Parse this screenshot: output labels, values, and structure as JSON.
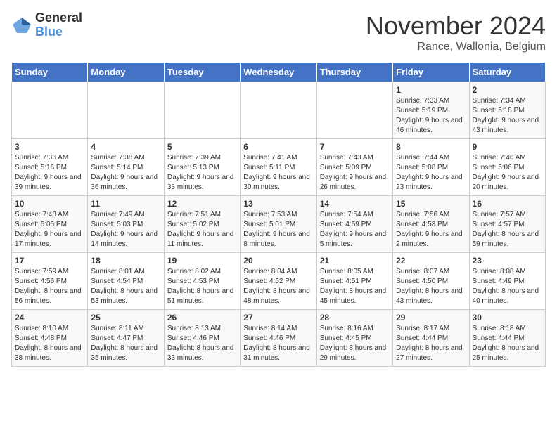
{
  "logo": {
    "general": "General",
    "blue": "Blue"
  },
  "title": "November 2024",
  "subtitle": "Rance, Wallonia, Belgium",
  "days_header": [
    "Sunday",
    "Monday",
    "Tuesday",
    "Wednesday",
    "Thursday",
    "Friday",
    "Saturday"
  ],
  "weeks": [
    [
      {
        "day": "",
        "info": ""
      },
      {
        "day": "",
        "info": ""
      },
      {
        "day": "",
        "info": ""
      },
      {
        "day": "",
        "info": ""
      },
      {
        "day": "",
        "info": ""
      },
      {
        "day": "1",
        "info": "Sunrise: 7:33 AM\nSunset: 5:19 PM\nDaylight: 9 hours and 46 minutes."
      },
      {
        "day": "2",
        "info": "Sunrise: 7:34 AM\nSunset: 5:18 PM\nDaylight: 9 hours and 43 minutes."
      }
    ],
    [
      {
        "day": "3",
        "info": "Sunrise: 7:36 AM\nSunset: 5:16 PM\nDaylight: 9 hours and 39 minutes."
      },
      {
        "day": "4",
        "info": "Sunrise: 7:38 AM\nSunset: 5:14 PM\nDaylight: 9 hours and 36 minutes."
      },
      {
        "day": "5",
        "info": "Sunrise: 7:39 AM\nSunset: 5:13 PM\nDaylight: 9 hours and 33 minutes."
      },
      {
        "day": "6",
        "info": "Sunrise: 7:41 AM\nSunset: 5:11 PM\nDaylight: 9 hours and 30 minutes."
      },
      {
        "day": "7",
        "info": "Sunrise: 7:43 AM\nSunset: 5:09 PM\nDaylight: 9 hours and 26 minutes."
      },
      {
        "day": "8",
        "info": "Sunrise: 7:44 AM\nSunset: 5:08 PM\nDaylight: 9 hours and 23 minutes."
      },
      {
        "day": "9",
        "info": "Sunrise: 7:46 AM\nSunset: 5:06 PM\nDaylight: 9 hours and 20 minutes."
      }
    ],
    [
      {
        "day": "10",
        "info": "Sunrise: 7:48 AM\nSunset: 5:05 PM\nDaylight: 9 hours and 17 minutes."
      },
      {
        "day": "11",
        "info": "Sunrise: 7:49 AM\nSunset: 5:03 PM\nDaylight: 9 hours and 14 minutes."
      },
      {
        "day": "12",
        "info": "Sunrise: 7:51 AM\nSunset: 5:02 PM\nDaylight: 9 hours and 11 minutes."
      },
      {
        "day": "13",
        "info": "Sunrise: 7:53 AM\nSunset: 5:01 PM\nDaylight: 9 hours and 8 minutes."
      },
      {
        "day": "14",
        "info": "Sunrise: 7:54 AM\nSunset: 4:59 PM\nDaylight: 9 hours and 5 minutes."
      },
      {
        "day": "15",
        "info": "Sunrise: 7:56 AM\nSunset: 4:58 PM\nDaylight: 9 hours and 2 minutes."
      },
      {
        "day": "16",
        "info": "Sunrise: 7:57 AM\nSunset: 4:57 PM\nDaylight: 8 hours and 59 minutes."
      }
    ],
    [
      {
        "day": "17",
        "info": "Sunrise: 7:59 AM\nSunset: 4:56 PM\nDaylight: 8 hours and 56 minutes."
      },
      {
        "day": "18",
        "info": "Sunrise: 8:01 AM\nSunset: 4:54 PM\nDaylight: 8 hours and 53 minutes."
      },
      {
        "day": "19",
        "info": "Sunrise: 8:02 AM\nSunset: 4:53 PM\nDaylight: 8 hours and 51 minutes."
      },
      {
        "day": "20",
        "info": "Sunrise: 8:04 AM\nSunset: 4:52 PM\nDaylight: 8 hours and 48 minutes."
      },
      {
        "day": "21",
        "info": "Sunrise: 8:05 AM\nSunset: 4:51 PM\nDaylight: 8 hours and 45 minutes."
      },
      {
        "day": "22",
        "info": "Sunrise: 8:07 AM\nSunset: 4:50 PM\nDaylight: 8 hours and 43 minutes."
      },
      {
        "day": "23",
        "info": "Sunrise: 8:08 AM\nSunset: 4:49 PM\nDaylight: 8 hours and 40 minutes."
      }
    ],
    [
      {
        "day": "24",
        "info": "Sunrise: 8:10 AM\nSunset: 4:48 PM\nDaylight: 8 hours and 38 minutes."
      },
      {
        "day": "25",
        "info": "Sunrise: 8:11 AM\nSunset: 4:47 PM\nDaylight: 8 hours and 35 minutes."
      },
      {
        "day": "26",
        "info": "Sunrise: 8:13 AM\nSunset: 4:46 PM\nDaylight: 8 hours and 33 minutes."
      },
      {
        "day": "27",
        "info": "Sunrise: 8:14 AM\nSunset: 4:46 PM\nDaylight: 8 hours and 31 minutes."
      },
      {
        "day": "28",
        "info": "Sunrise: 8:16 AM\nSunset: 4:45 PM\nDaylight: 8 hours and 29 minutes."
      },
      {
        "day": "29",
        "info": "Sunrise: 8:17 AM\nSunset: 4:44 PM\nDaylight: 8 hours and 27 minutes."
      },
      {
        "day": "30",
        "info": "Sunrise: 8:18 AM\nSunset: 4:44 PM\nDaylight: 8 hours and 25 minutes."
      }
    ]
  ]
}
